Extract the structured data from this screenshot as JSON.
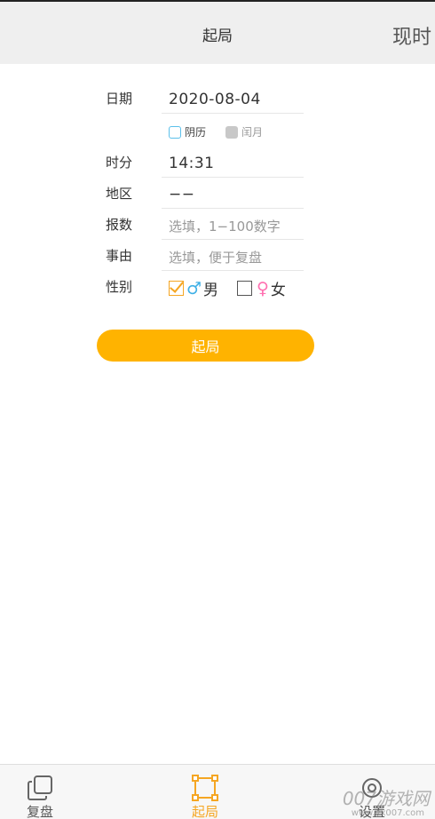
{
  "header": {
    "title": "起局",
    "right_action": "现时"
  },
  "form": {
    "date": {
      "label": "日期",
      "value": "2020-08-04"
    },
    "calendar": {
      "lunar_label": "阴历",
      "leap_label": "闰月"
    },
    "time": {
      "label": "时分",
      "value": "14:31"
    },
    "region": {
      "label": "地区",
      "value": "−−"
    },
    "number": {
      "label": "报数",
      "placeholder": "选填，1−100数字"
    },
    "reason": {
      "label": "事由",
      "placeholder": "选填，便于复盘"
    },
    "gender": {
      "label": "性别",
      "male_symbol": "♂",
      "male_label": "男",
      "female_symbol": "♀",
      "female_label": "女",
      "selected": "male"
    }
  },
  "start_button": {
    "label": "起局",
    "color": "#ffb300"
  },
  "tabbar": {
    "tabs": [
      {
        "label": "复盘",
        "icon": "copy-icon"
      },
      {
        "label": "起局",
        "icon": "frame-icon",
        "active": true
      },
      {
        "label": "设置",
        "icon": "settings-icon"
      }
    ],
    "active_color": "#f5a623"
  },
  "watermark": {
    "text": "007游戏网",
    "url": "www.yx007.com"
  }
}
